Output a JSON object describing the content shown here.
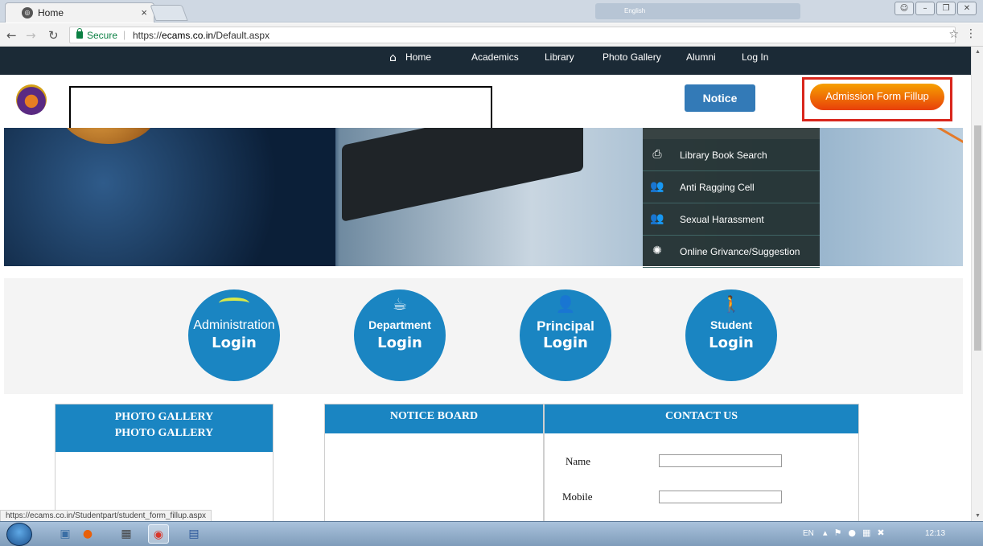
{
  "browser": {
    "tab_title": "Home",
    "tab_close": "×",
    "secure_label": "Secure",
    "url_scheme": "https://",
    "url_domain": "ecams.co.in",
    "url_path": "/Default.aspx",
    "ime_label": "English"
  },
  "nav": {
    "home": "Home",
    "academics": "Academics",
    "library": "Library",
    "photo_gallery": "Photo Gallery",
    "alumni": "Alumni",
    "login": "Log In"
  },
  "header": {
    "notice_button": "Notice",
    "admission_button": "Admission Form Fillup"
  },
  "quick_menu": [
    {
      "icon": "book-search-icon",
      "label": "Library Book Search"
    },
    {
      "icon": "group-icon",
      "label": "Anti Ragging Cell"
    },
    {
      "icon": "group-icon",
      "label": "Sexual Harassment"
    },
    {
      "icon": "bulb-icon",
      "label": "Online Grivance/Suggestion"
    }
  ],
  "logins": [
    {
      "line1": "Administration",
      "line2": "Login"
    },
    {
      "line1": "Department",
      "line2": "Login"
    },
    {
      "line1": "Principal",
      "line2": "Login"
    },
    {
      "line1": "Student",
      "line2": "Login"
    }
  ],
  "panels": {
    "gallery_title_1": "PHOTO GALLERY",
    "gallery_title_2": "PHOTO GALLERY",
    "notice_title": "NOTICE BOARD",
    "contact_title": "CONTACT US",
    "contact_name_label": "Name",
    "contact_mobile_label": "Mobile"
  },
  "status_url": "https://ecams.co.in/Studentpart/student_form_fillup.aspx",
  "taskbar": {
    "lang": "EN",
    "clock": "12:13"
  },
  "colors": {
    "nav_bg": "#1b2a36",
    "accent_blue": "#1a85c2",
    "notice_blue": "#337ab7",
    "admission_orange": "#e8400a",
    "highlight_red": "#d9261c"
  }
}
